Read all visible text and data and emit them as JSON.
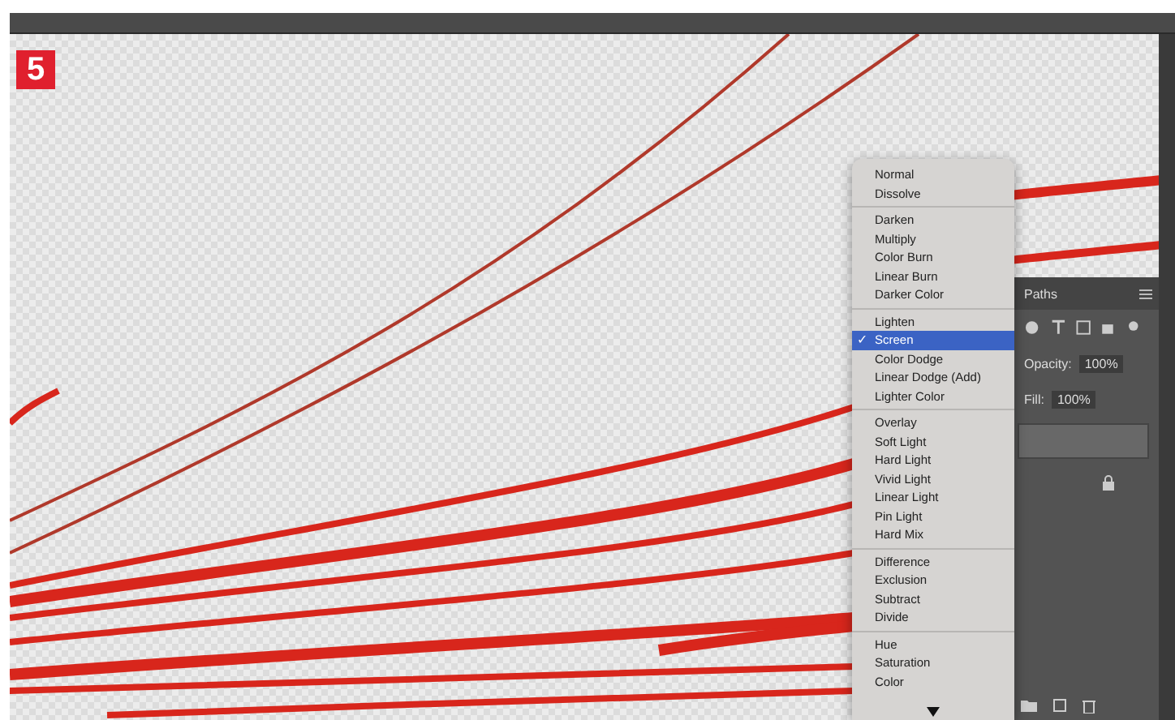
{
  "step_badge": "5",
  "blend_menu": {
    "groups": [
      {
        "items": [
          {
            "label": "Normal",
            "selected": false
          },
          {
            "label": "Dissolve",
            "selected": false
          }
        ]
      },
      {
        "items": [
          {
            "label": "Darken",
            "selected": false
          },
          {
            "label": "Multiply",
            "selected": false
          },
          {
            "label": "Color Burn",
            "selected": false
          },
          {
            "label": "Linear Burn",
            "selected": false
          },
          {
            "label": "Darker Color",
            "selected": false
          }
        ]
      },
      {
        "items": [
          {
            "label": "Lighten",
            "selected": false
          },
          {
            "label": "Screen",
            "selected": true
          },
          {
            "label": "Color Dodge",
            "selected": false
          },
          {
            "label": "Linear Dodge (Add)",
            "selected": false
          },
          {
            "label": "Lighter Color",
            "selected": false
          }
        ]
      },
      {
        "items": [
          {
            "label": "Overlay",
            "selected": false
          },
          {
            "label": "Soft Light",
            "selected": false
          },
          {
            "label": "Hard Light",
            "selected": false
          },
          {
            "label": "Vivid Light",
            "selected": false
          },
          {
            "label": "Linear Light",
            "selected": false
          },
          {
            "label": "Pin Light",
            "selected": false
          },
          {
            "label": "Hard Mix",
            "selected": false
          }
        ]
      },
      {
        "items": [
          {
            "label": "Difference",
            "selected": false
          },
          {
            "label": "Exclusion",
            "selected": false
          },
          {
            "label": "Subtract",
            "selected": false
          },
          {
            "label": "Divide",
            "selected": false
          }
        ]
      },
      {
        "items": [
          {
            "label": "Hue",
            "selected": false
          },
          {
            "label": "Saturation",
            "selected": false
          },
          {
            "label": "Color",
            "selected": false
          }
        ]
      }
    ],
    "check_mark": "✓"
  },
  "layers_panel": {
    "tab": "Paths",
    "opacity_label": "Opacity:",
    "opacity": "100%",
    "fill_label": "Fill:",
    "fill": "100%"
  }
}
